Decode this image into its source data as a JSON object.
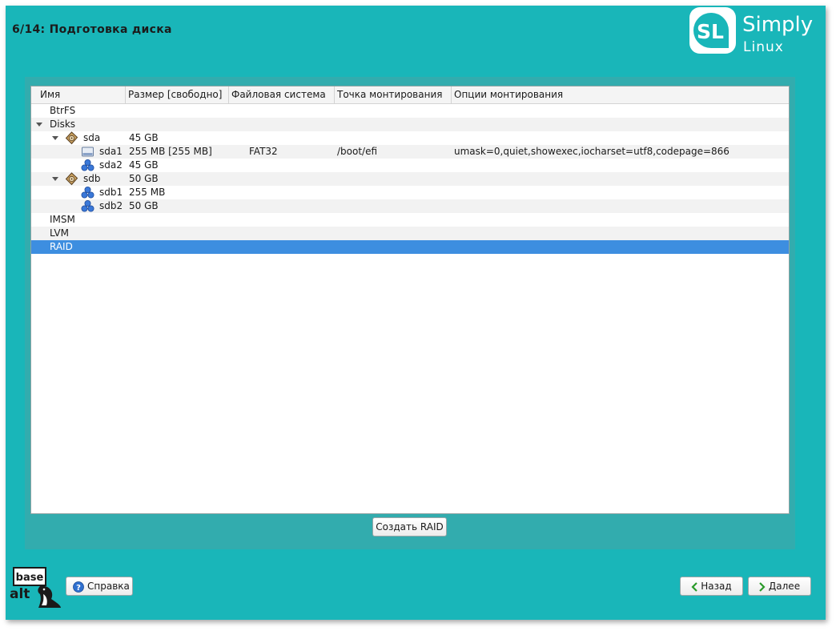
{
  "header": {
    "step_title": "6/14: Подготовка диска",
    "logo_word1": "Simply",
    "logo_word2": "Linux",
    "logo_badge": "SL"
  },
  "table": {
    "columns": [
      "Имя",
      "Размер [свободно]",
      "Файловая система",
      "Точка монтирования",
      "Опции монтирования"
    ],
    "rows": [
      {
        "name": "BtrFS",
        "size": "",
        "fs": "",
        "mount": "",
        "options": ""
      },
      {
        "name": "Disks",
        "size": "",
        "fs": "",
        "mount": "",
        "options": ""
      },
      {
        "name": "sda",
        "size": "45 GB",
        "fs": "",
        "mount": "",
        "options": ""
      },
      {
        "name": "sda1",
        "size": "255 MB [255 MB]",
        "fs": "FAT32",
        "mount": "/boot/efi",
        "options": "umask=0,quiet,showexec,iocharset=utf8,codepage=866"
      },
      {
        "name": "sda2",
        "size": "45 GB",
        "fs": "",
        "mount": "",
        "options": ""
      },
      {
        "name": "sdb",
        "size": "50 GB",
        "fs": "",
        "mount": "",
        "options": ""
      },
      {
        "name": "sdb1",
        "size": "255 MB",
        "fs": "",
        "mount": "",
        "options": ""
      },
      {
        "name": "sdb2",
        "size": "50 GB",
        "fs": "",
        "mount": "",
        "options": ""
      },
      {
        "name": "IMSM",
        "size": "",
        "fs": "",
        "mount": "",
        "options": ""
      },
      {
        "name": "LVM",
        "size": "",
        "fs": "",
        "mount": "",
        "options": ""
      },
      {
        "name": "RAID",
        "size": "",
        "fs": "",
        "mount": "",
        "options": ""
      }
    ],
    "selected_row": "RAID"
  },
  "buttons": {
    "create_raid": "Создать RAID",
    "help": "Справка",
    "back": "Назад",
    "next": "Далее"
  },
  "footer": {
    "brand_line1": "base",
    "brand_line2": "alt"
  },
  "colors": {
    "window_bg": "#19b6b9",
    "selection": "#3d8ee0"
  }
}
